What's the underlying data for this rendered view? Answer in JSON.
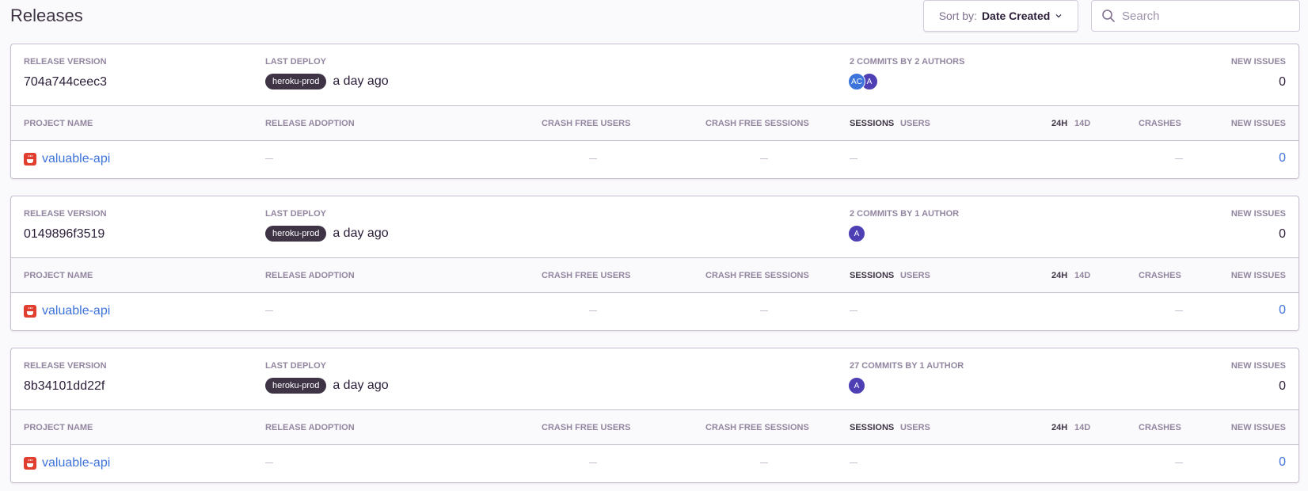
{
  "header": {
    "title": "Releases",
    "sort_label": "Sort by:",
    "sort_value": "Date Created",
    "search_placeholder": "Search"
  },
  "colors": {
    "accent_link": "#3d74db",
    "badge_bg": "#3e3446",
    "avatar_ac": "#3d74db",
    "avatar_a": "#4e3fb4",
    "project_icon": "#e03e2f"
  },
  "labels": {
    "release_version": "Release Version",
    "last_deploy": "Last Deploy",
    "new_issues": "New Issues",
    "project_name": "Project Name",
    "release_adoption": "Release Adoption",
    "crash_free_users": "Crash Free Users",
    "crash_free_sessions": "Crash Free Sessions",
    "sessions": "Sessions",
    "users": "Users",
    "period_24h": "24h",
    "period_14d": "14d",
    "crashes": "Crashes",
    "empty": "—"
  },
  "releases": [
    {
      "version": "704a744ceec3",
      "environment": "heroku-prod",
      "deploy_time": "a day ago",
      "commits": "2 commits by 2 authors",
      "authors": [
        "AC",
        "A"
      ],
      "new_issues": "0",
      "project": {
        "name": "valuable-api",
        "new_issues": "0"
      }
    },
    {
      "version": "0149896f3519",
      "environment": "heroku-prod",
      "deploy_time": "a day ago",
      "commits": "2 commits by 1 author",
      "authors": [
        "A"
      ],
      "new_issues": "0",
      "project": {
        "name": "valuable-api",
        "new_issues": "0"
      }
    },
    {
      "version": "8b34101dd22f",
      "environment": "heroku-prod",
      "deploy_time": "a day ago",
      "commits": "27 commits by 1 author",
      "authors": [
        "A"
      ],
      "new_issues": "0",
      "project": {
        "name": "valuable-api",
        "new_issues": "0"
      }
    }
  ]
}
